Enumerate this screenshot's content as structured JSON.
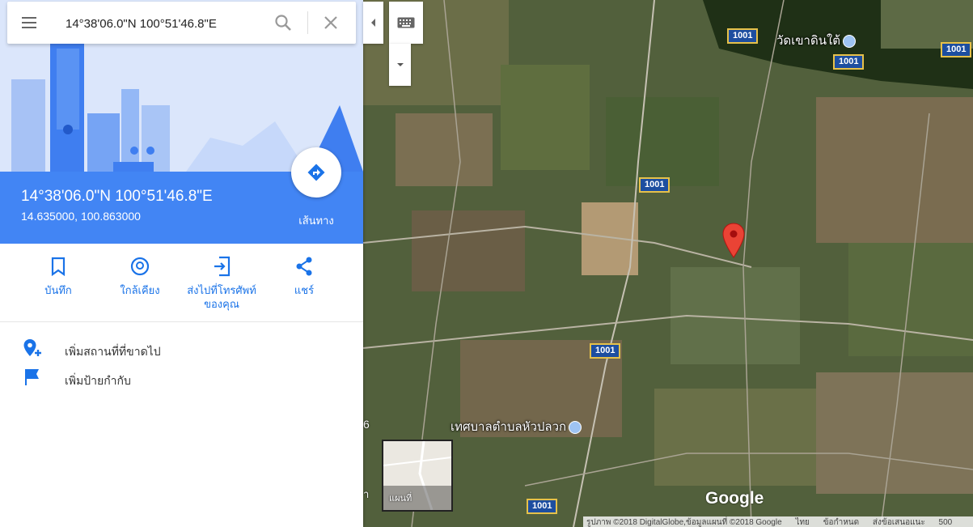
{
  "search": {
    "value": "14°38'06.0\"N 100°51'46.8\"E"
  },
  "place": {
    "title": "14°38'06.0\"N 100°51'46.8\"E",
    "coords": "14.635000, 100.863000",
    "directions_label": "เส้นทาง"
  },
  "actions": [
    {
      "label": "บันทึก",
      "icon": "bookmark-icon"
    },
    {
      "label": "ใกล้เคียง",
      "icon": "nearby-icon"
    },
    {
      "label": "ส่งไปที่โทรศัพท์ของคุณ",
      "icon": "send-to-phone-icon"
    },
    {
      "label": "แชร์",
      "icon": "share-icon"
    }
  ],
  "rows": [
    {
      "label": "เพิ่มสถานที่ที่ขาดไป",
      "icon": "add-place-icon"
    },
    {
      "label": "เพิ่มป้ายกำกับ",
      "icon": "flag-icon"
    }
  ],
  "map": {
    "road_shields": [
      "1001",
      "1001",
      "1001",
      "1001",
      "1001",
      "1001"
    ],
    "places": [
      "วัดเขาดินใต้",
      "เทศบาลตำบลหัวปลวก"
    ],
    "minimap_label": "แผนที่",
    "google_logo": "Google",
    "edge_number": "6",
    "edge_text": "า",
    "footer": [
      "รูปภาพ ©2018 DigitalGlobe,ข้อมูลแผนที่ ©2018 Google",
      "ไทย",
      "ข้อกำหนด",
      "ส่งข้อเสนอแนะ",
      "500"
    ]
  },
  "colors": {
    "accent": "#4285f4",
    "action_blue": "#1a73e8",
    "pin_red": "#ea4335"
  }
}
